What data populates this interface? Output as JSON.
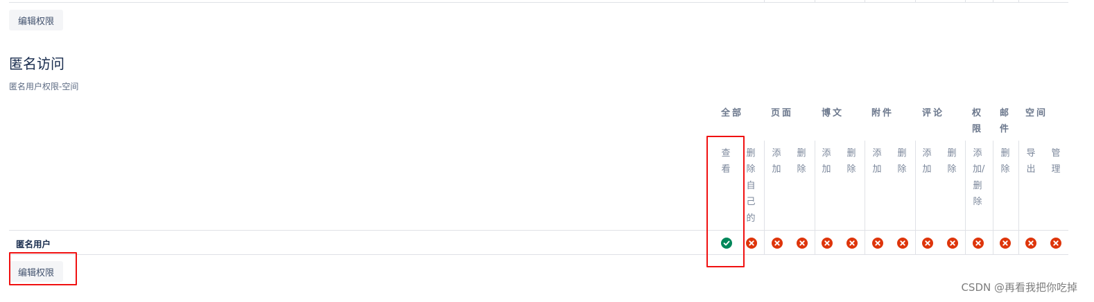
{
  "edit_button_label": "编辑权限",
  "section": {
    "title": "匿名访问",
    "subtitle": "匿名用户权限-空间"
  },
  "table": {
    "groups": [
      "全部",
      "页面",
      "博文",
      "附件",
      "评论",
      "权限",
      "邮件",
      "空间"
    ],
    "columns": [
      "查看",
      "删除自己的",
      "添加",
      "删除",
      "添加",
      "删除",
      "添加",
      "删除",
      "添加",
      "删除",
      "添加/删除",
      "删除",
      "导出",
      "管理"
    ],
    "row": {
      "label": "匿名用户",
      "permissions": [
        true,
        false,
        false,
        false,
        false,
        false,
        false,
        false,
        false,
        false,
        false,
        false,
        false,
        false
      ]
    }
  },
  "icons": {
    "granted": "check-circle-icon",
    "denied": "cross-circle-icon"
  },
  "colors": {
    "granted": "#00875a",
    "denied": "#de350b",
    "highlight": "#f01010"
  },
  "watermark": "CSDN @再看我把你吃掉"
}
